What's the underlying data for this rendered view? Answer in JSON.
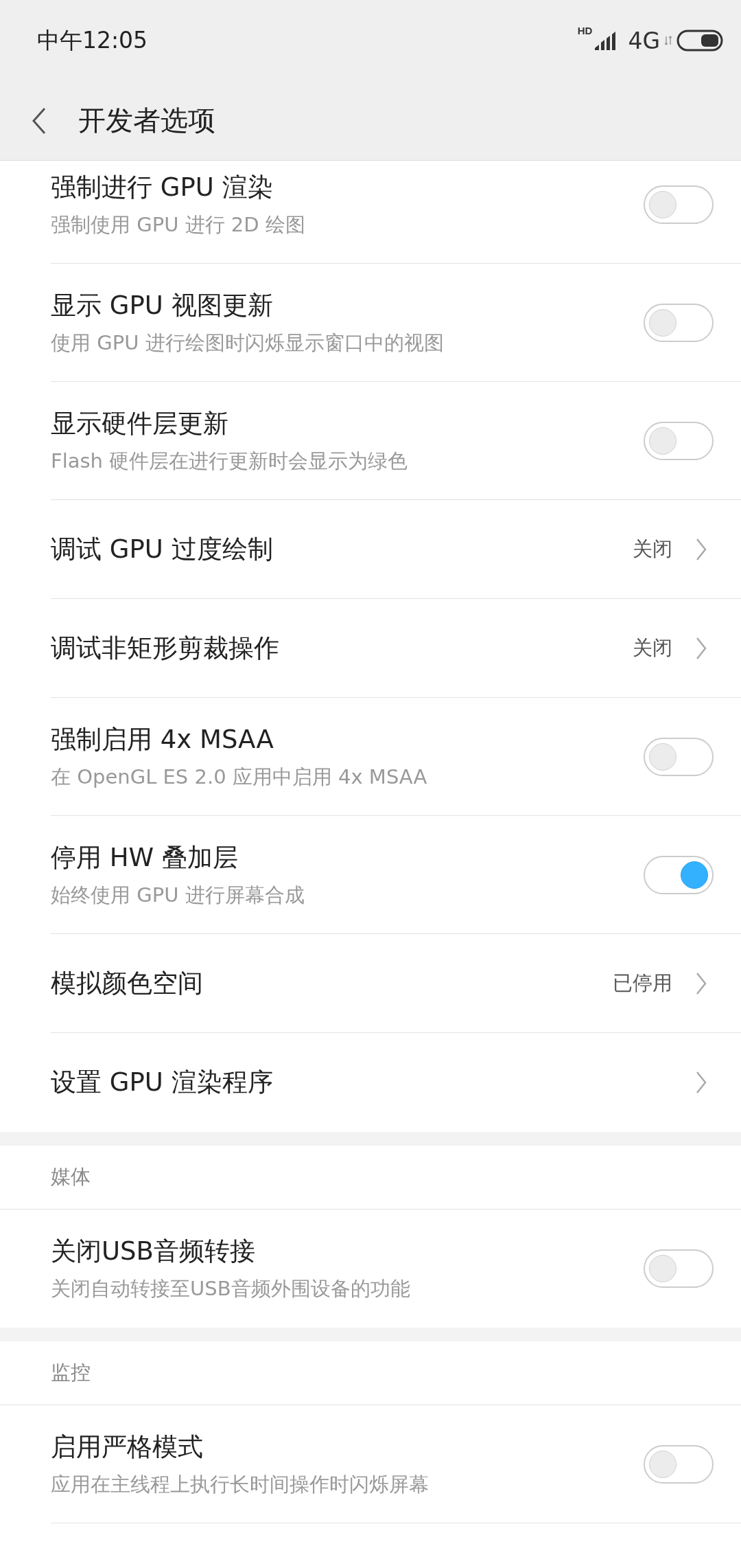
{
  "status_bar": {
    "time": "中午12:05",
    "network": "4G",
    "signal_label": "HD"
  },
  "header": {
    "title": "开发者选项"
  },
  "sections": [
    {
      "items": [
        {
          "kind": "toggle",
          "title": "强制进行 GPU 渲染",
          "subtitle": "强制使用 GPU 进行 2D 绘图",
          "on": false
        },
        {
          "kind": "toggle",
          "title": "显示 GPU 视图更新",
          "subtitle": "使用 GPU 进行绘图时闪烁显示窗口中的视图",
          "on": false
        },
        {
          "kind": "toggle",
          "title": "显示硬件层更新",
          "subtitle": "Flash 硬件层在进行更新时会显示为绿色",
          "on": false
        },
        {
          "kind": "link",
          "title": "调试 GPU 过度绘制",
          "value": "关闭"
        },
        {
          "kind": "link",
          "title": "调试非矩形剪裁操作",
          "value": "关闭"
        },
        {
          "kind": "toggle",
          "title": "强制启用 4x MSAA",
          "subtitle": "在 OpenGL ES 2.0 应用中启用 4x MSAA",
          "on": false
        },
        {
          "kind": "toggle",
          "title": "停用 HW 叠加层",
          "subtitle": "始终使用 GPU 进行屏幕合成",
          "on": true
        },
        {
          "kind": "link",
          "title": "模拟颜色空间",
          "value": "已停用"
        },
        {
          "kind": "link",
          "title": "设置 GPU 渲染程序"
        }
      ]
    },
    {
      "header": "媒体",
      "items": [
        {
          "kind": "toggle",
          "title": "关闭USB音频转接",
          "subtitle": "关闭自动转接至USB音频外围设备的功能",
          "on": false
        }
      ]
    },
    {
      "header": "监控",
      "items": [
        {
          "kind": "toggle",
          "title": "启用严格模式",
          "subtitle": "应用在主线程上执行长时间操作时闪烁屏幕",
          "on": false
        }
      ]
    }
  ]
}
